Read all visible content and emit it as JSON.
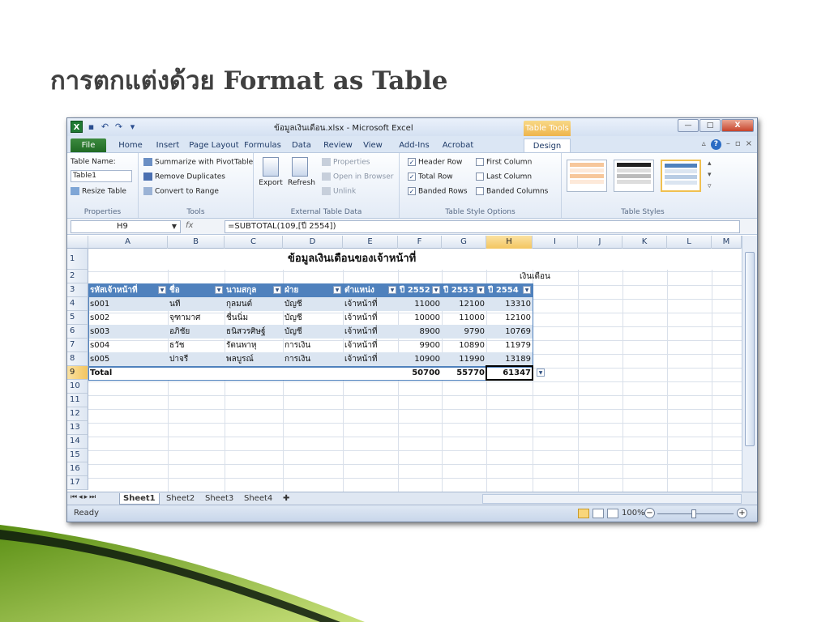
{
  "slide": {
    "title": "การตกแต่งด้วย Format as Table"
  },
  "window": {
    "title": "ข้อมูลเงินเดือน.xlsx - Microsoft Excel",
    "context_tab": "Table Tools",
    "app_icon": "X",
    "buttons": {
      "minimize": "—",
      "restore": "□",
      "close": "X"
    }
  },
  "tabs": [
    {
      "label": "File"
    },
    {
      "label": "Home"
    },
    {
      "label": "Insert"
    },
    {
      "label": "Page Layout"
    },
    {
      "label": "Formulas"
    },
    {
      "label": "Data"
    },
    {
      "label": "Review"
    },
    {
      "label": "View"
    },
    {
      "label": "Add-Ins"
    },
    {
      "label": "Acrobat"
    },
    {
      "label": "Design"
    }
  ],
  "ribbon": {
    "properties": {
      "table_name_label": "Table Name:",
      "table_name_value": "Table1",
      "resize_table": "Resize Table",
      "group_label": "Properties"
    },
    "tools": {
      "summarize": "Summarize with PivotTable",
      "remove_duplicates": "Remove Duplicates",
      "convert_to_range": "Convert to Range",
      "group_label": "Tools"
    },
    "external": {
      "export": "Export",
      "refresh": "Refresh",
      "properties": "Properties",
      "open_in_browser": "Open in Browser",
      "unlink": "Unlink",
      "group_label": "External Table Data"
    },
    "style_options": {
      "header_row": {
        "label": "Header Row",
        "checked": true
      },
      "total_row": {
        "label": "Total Row",
        "checked": true
      },
      "banded_rows": {
        "label": "Banded Rows",
        "checked": true
      },
      "first_column": {
        "label": "First Column",
        "checked": false
      },
      "last_column": {
        "label": "Last Column",
        "checked": false
      },
      "banded_columns": {
        "label": "Banded Columns",
        "checked": false
      },
      "group_label": "Table Style Options"
    },
    "table_styles": {
      "group_label": "Table Styles"
    }
  },
  "formula_bar": {
    "name_box": "H9",
    "fx": "fx",
    "formula": "=SUBTOTAL(109,[ปี 2554])"
  },
  "columns": [
    "A",
    "B",
    "C",
    "D",
    "E",
    "F",
    "G",
    "H",
    "I",
    "J",
    "K",
    "L",
    "M"
  ],
  "rows": [
    "1",
    "2",
    "3",
    "4",
    "5",
    "6",
    "7",
    "8",
    "9",
    "10",
    "11",
    "12",
    "13",
    "14",
    "15",
    "16",
    "17"
  ],
  "sheet": {
    "title": "ข้อมูลเงินเดือนของเจ้าหน้าที่",
    "subtitle": "เงินเดือน",
    "headers": [
      "รหัสเจ้าหน้าที่",
      "ชื่อ",
      "นามสกุล",
      "ฝ่าย",
      "ตำแหน่ง",
      "ปี 2552",
      "ปี 2553",
      "ปี 2554"
    ],
    "data": [
      [
        "s001",
        "นที",
        "กุลมนต์",
        "บัญชี",
        "เจ้าหน้าที่",
        "11000",
        "12100",
        "13310"
      ],
      [
        "s002",
        "จุฑามาศ",
        "ชื่นนิ่ม",
        "บัญชี",
        "เจ้าหน้าที่",
        "10000",
        "11000",
        "12100"
      ],
      [
        "s003",
        "อภิชัย",
        "ธนิสวรศิษฐ์",
        "บัญชี",
        "เจ้าหน้าที่",
        "8900",
        "9790",
        "10769"
      ],
      [
        "s004",
        "ธวัช",
        "รัตนพาหุ",
        "การเงิน",
        "เจ้าหน้าที่",
        "9900",
        "10890",
        "11979"
      ],
      [
        "s005",
        "ปาจรี",
        "พลบูรณ์",
        "การเงิน",
        "เจ้าหน้าที่",
        "10900",
        "11990",
        "13189"
      ]
    ],
    "total": {
      "label": "Total",
      "f": "50700",
      "g": "55770",
      "h": "61347"
    }
  },
  "sheet_tabs": [
    "Sheet1",
    "Sheet2",
    "Sheet3",
    "Sheet4"
  ],
  "status": {
    "ready": "Ready",
    "zoom": "100%"
  },
  "colors": {
    "header_blue": "#4f81bd",
    "band": "#dbe5f1",
    "excel_green": "#1f7a33",
    "tools_orange": "#eeb44c"
  }
}
